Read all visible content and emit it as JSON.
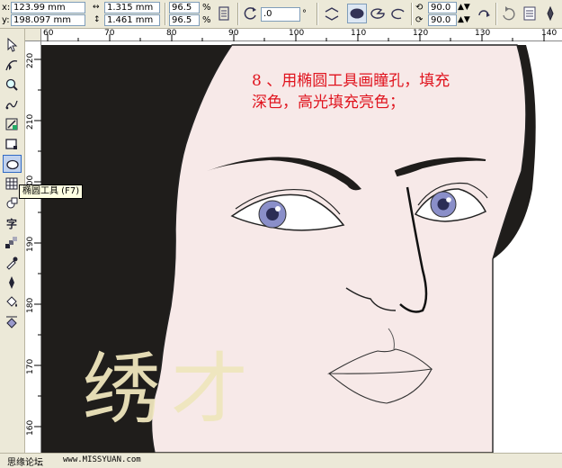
{
  "property_bar": {
    "x_label": "x:",
    "x_value": "123.99 mm",
    "y_label": "y:",
    "y_value": "198.097 mm",
    "width_value": "1.315 mm",
    "height_value": "1.461 mm",
    "scale_x": "96.5",
    "scale_y": "96.5",
    "percent_symbol": "%",
    "rotation_value": ".0",
    "start_angle": "90.0",
    "end_angle": "90.0"
  },
  "tooltip": {
    "text": "椭圆工具 (F7)"
  },
  "rulers": {
    "horizontal": [
      "60",
      "70",
      "80",
      "90",
      "100",
      "110",
      "120",
      "130",
      "140"
    ],
    "vertical": [
      "220",
      "210",
      "200",
      "190",
      "180",
      "170",
      "160"
    ]
  },
  "instruction": {
    "line1": "8 、用椭圆工具画瞳孔，填充",
    "line2": "深色，高光填充亮色；"
  },
  "watermark": {
    "text": "绣才"
  },
  "footer": {
    "site_name": "思缘论坛",
    "site_url": "www.MISSYUAN.com"
  },
  "colors": {
    "hair": "#1f1d1b",
    "skin": "#f7e9e8",
    "iris": "#8a8fc9",
    "instruction_text": "#e0141e",
    "watermark": "#efe6bd",
    "ui_panel": "#ece9d8"
  },
  "icons": {
    "tools": [
      "pick-tool-icon",
      "shape-tool-icon",
      "zoom-tool-icon",
      "freehand-tool-icon",
      "smart-fill-tool-icon",
      "rectangle-tool-icon",
      "ellipse-tool-icon",
      "polygon-tool-icon",
      "basic-shapes-tool-icon",
      "text-tool-icon",
      "interactive-blend-tool-icon",
      "eyedropper-tool-icon",
      "outline-tool-icon",
      "fill-tool-icon",
      "interactive-fill-tool-icon"
    ]
  }
}
